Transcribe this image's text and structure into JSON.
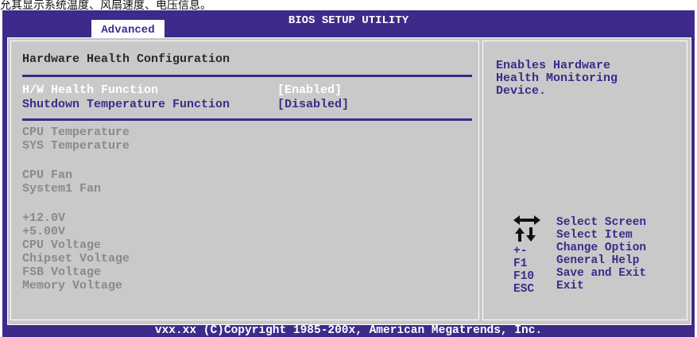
{
  "caption": "允其显示系统温度、风扇速度、电压信息。",
  "header": {
    "title": "BIOS SETUP UTILITY",
    "tab": "Advanced"
  },
  "left": {
    "heading": "Hardware Health Configuration",
    "options": [
      {
        "label": "H/W Health Function",
        "value": "[Enabled]"
      },
      {
        "label": "Shutdown Temperature Function",
        "value": "[Disabled]"
      }
    ],
    "temps": [
      "CPU Temperature",
      "SYS Temperature"
    ],
    "fans": [
      "CPU Fan",
      "System1 Fan"
    ],
    "voltages": [
      "+12.0V",
      "+5.00V",
      "CPU Voltage",
      "Chipset Voltage",
      "FSB Voltage",
      "Memory Voltage"
    ]
  },
  "help": {
    "lines": [
      "Enables Hardware",
      "Health Monitoring",
      "Device."
    ]
  },
  "keys": [
    {
      "key": "arrows-lr-icon",
      "desc": "Select Screen"
    },
    {
      "key": "arrows-ud-icon",
      "desc": "Select Item"
    },
    {
      "key": "+-",
      "desc": "Change Option"
    },
    {
      "key": "F1",
      "desc": "General Help"
    },
    {
      "key": "F10",
      "desc": "Save and Exit"
    },
    {
      "key": "ESC",
      "desc": "Exit"
    }
  ],
  "footer": "vxx.xx (C)Copyright 1985-200x, American Megatrends, Inc.",
  "colors": {
    "frame": "#3d2a8a",
    "panel": "#c9c9c9",
    "highlight": "#ffffff",
    "disabled": "#8a8a8a"
  }
}
